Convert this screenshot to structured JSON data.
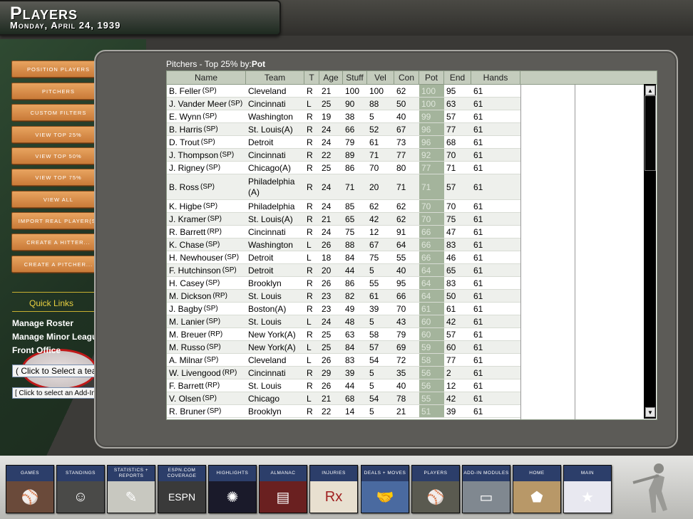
{
  "header": {
    "title": "Players",
    "date": "Monday, April 24, 1939"
  },
  "sidebar": {
    "buttons": [
      "Position Players",
      "Pitchers",
      "Custom Filters",
      "View Top 25%",
      "View Top 50%",
      "View Top 75%",
      "View All",
      "Import Real Player(s)",
      "Create a Hitter...",
      "Create a Pitcher..."
    ],
    "quick_links_title": "Quick Links",
    "quick_links": [
      "Manage Roster",
      "Manage Minor Leagues",
      "Front Office"
    ],
    "team_select": "( Click to Select a team )",
    "addin_select": "[ Click to select an Add-In ]"
  },
  "table": {
    "caption_prefix": "Pitchers - Top 25% by:",
    "caption_sort": "Pot",
    "columns": [
      "Name",
      "Team",
      "T",
      "Age",
      "Stuff",
      "Vel",
      "Con",
      "Pot",
      "End",
      "Hands"
    ],
    "rows": [
      [
        "B. Feller",
        "SP",
        "Cleveland",
        "R",
        "21",
        "100",
        "100",
        "62",
        "100",
        "95",
        "61"
      ],
      [
        "J. Vander Meer",
        "SP",
        "Cincinnati",
        "L",
        "25",
        "90",
        "88",
        "50",
        "100",
        "63",
        "61"
      ],
      [
        "E. Wynn",
        "SP",
        "Washington",
        "R",
        "19",
        "38",
        "5",
        "40",
        "99",
        "57",
        "61"
      ],
      [
        "B. Harris",
        "SP",
        "St. Louis(A)",
        "R",
        "24",
        "66",
        "52",
        "67",
        "96",
        "77",
        "61"
      ],
      [
        "D. Trout",
        "SP",
        "Detroit",
        "R",
        "24",
        "79",
        "61",
        "73",
        "96",
        "68",
        "61"
      ],
      [
        "J. Thompson",
        "SP",
        "Cincinnati",
        "R",
        "22",
        "89",
        "71",
        "77",
        "92",
        "70",
        "61"
      ],
      [
        "J. Rigney",
        "SP",
        "Chicago(A)",
        "R",
        "25",
        "86",
        "70",
        "80",
        "77",
        "71",
        "61"
      ],
      [
        "B. Ross",
        "SP",
        "Philadelphia (A)",
        "R",
        "24",
        "71",
        "20",
        "71",
        "71",
        "57",
        "61"
      ],
      [
        "K. Higbe",
        "SP",
        "Philadelphia",
        "R",
        "24",
        "85",
        "62",
        "62",
        "70",
        "70",
        "61"
      ],
      [
        "J. Kramer",
        "SP",
        "St. Louis(A)",
        "R",
        "21",
        "65",
        "42",
        "62",
        "70",
        "75",
        "61"
      ],
      [
        "R. Barrett",
        "RP",
        "Cincinnati",
        "R",
        "24",
        "75",
        "12",
        "91",
        "66",
        "47",
        "61"
      ],
      [
        "K. Chase",
        "SP",
        "Washington",
        "L",
        "26",
        "88",
        "67",
        "64",
        "66",
        "83",
        "61"
      ],
      [
        "H. Newhouser",
        "SP",
        "Detroit",
        "L",
        "18",
        "84",
        "75",
        "55",
        "66",
        "46",
        "61"
      ],
      [
        "F. Hutchinson",
        "SP",
        "Detroit",
        "R",
        "20",
        "44",
        "5",
        "40",
        "64",
        "65",
        "61"
      ],
      [
        "H. Casey",
        "SP",
        "Brooklyn",
        "R",
        "26",
        "86",
        "55",
        "95",
        "64",
        "83",
        "61"
      ],
      [
        "M. Dickson",
        "RP",
        "St. Louis",
        "R",
        "23",
        "82",
        "61",
        "66",
        "64",
        "50",
        "61"
      ],
      [
        "J. Bagby",
        "SP",
        "Boston(A)",
        "R",
        "23",
        "49",
        "39",
        "70",
        "61",
        "61",
        "61"
      ],
      [
        "M. Lanier",
        "SP",
        "St. Louis",
        "L",
        "24",
        "48",
        "5",
        "43",
        "60",
        "42",
        "61"
      ],
      [
        "M. Breuer",
        "RP",
        "New York(A)",
        "R",
        "25",
        "63",
        "58",
        "79",
        "60",
        "57",
        "61"
      ],
      [
        "M. Russo",
        "SP",
        "New York(A)",
        "L",
        "25",
        "84",
        "57",
        "69",
        "59",
        "60",
        "61"
      ],
      [
        "A. Milnar",
        "SP",
        "Cleveland",
        "L",
        "26",
        "83",
        "54",
        "72",
        "58",
        "77",
        "61"
      ],
      [
        "W. Livengood",
        "RP",
        "Cincinnati",
        "R",
        "29",
        "39",
        "5",
        "35",
        "56",
        "2",
        "61"
      ],
      [
        "F. Barrett",
        "RP",
        "St. Louis",
        "R",
        "26",
        "44",
        "5",
        "40",
        "56",
        "12",
        "61"
      ],
      [
        "V. Olsen",
        "SP",
        "Chicago",
        "L",
        "21",
        "68",
        "54",
        "78",
        "55",
        "42",
        "61"
      ],
      [
        "R. Bruner",
        "SP",
        "Brooklyn",
        "R",
        "22",
        "14",
        "5",
        "21",
        "51",
        "39",
        "61"
      ]
    ]
  },
  "bottom_nav": [
    {
      "label": "Games",
      "icon": "batter-icon"
    },
    {
      "label": "Standings",
      "icon": "manager-icon"
    },
    {
      "label": "Statistics + Reports",
      "icon": "pencil-icon"
    },
    {
      "label": "ESPN.com Coverage",
      "icon": "espn-icon"
    },
    {
      "label": "Highlights",
      "icon": "fireworks-icon"
    },
    {
      "label": "Almanac",
      "icon": "books-icon"
    },
    {
      "label": "Injuries",
      "icon": "rx-icon"
    },
    {
      "label": "Deals + Moves",
      "icon": "handshake-icon"
    },
    {
      "label": "Players",
      "icon": "player-icon"
    },
    {
      "label": "Add-In Modules",
      "icon": "laptop-icon"
    },
    {
      "label": "Home",
      "icon": "home-plate-icon"
    },
    {
      "label": "Main",
      "icon": "logo-icon"
    }
  ],
  "colors": {
    "button_orange": "#d98c48",
    "sidebar_green": "#26392a",
    "pot_highlight": "#a4b49c",
    "quick_links_yellow": "#e8d040",
    "nav_blue": "#2c3e6a"
  }
}
